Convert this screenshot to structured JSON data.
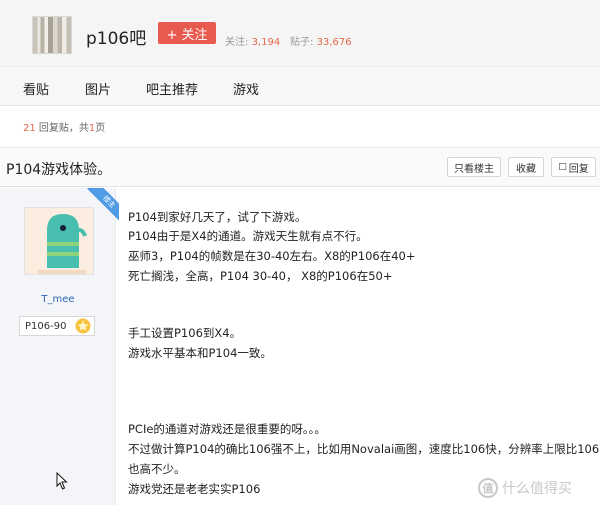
{
  "forum": {
    "name": "p106吧",
    "follow_label": "+ 关注",
    "follow_prefix": "关注:",
    "follow_count": "3,194",
    "posts_prefix": "贴子:",
    "posts_count": "33,676"
  },
  "nav": {
    "items": [
      "看贴",
      "图片",
      "吧主推荐",
      "游戏"
    ]
  },
  "summary": {
    "reply_count": "21",
    "reply_text": " 回复贴，共",
    "page_count": "1",
    "page_text": "页"
  },
  "thread": {
    "title": "P104游戏体验。",
    "only_op_label": "只看楼主",
    "favorite_label": "收藏",
    "reply_label": "回复"
  },
  "post": {
    "op_badge": "楼主",
    "username": "T_mee",
    "level_label": "P106-90",
    "lines": [
      "P104到家好几天了，试了下游戏。",
      "P104由于是X4的通道。游戏天生就有点不行。",
      "巫师3，P104的帧数是在30-40左右。X8的P106在40+",
      "死亡搁浅，全高，P104 30-40， X8的P106在50+",
      "手工设置P106到X4。",
      "游戏水平基本和P104一致。",
      "PCIe的通道对游戏还是很重要的呀。。。",
      "不过做计算P104的确比106强不上，比如用Novalai画图，速度比106快，分辨率上限比106",
      "也高不少。",
      "游戏党还是老老实实P106"
    ]
  },
  "watermark": {
    "logo": "值",
    "text": "什么值得买"
  },
  "colors": {
    "accent": "#e85a4f",
    "link": "#2d64b3",
    "count": "#e0694b",
    "badge": "#4f9be6"
  },
  "icons": [
    "reply-icon",
    "star-icon",
    "cursor-icon"
  ]
}
